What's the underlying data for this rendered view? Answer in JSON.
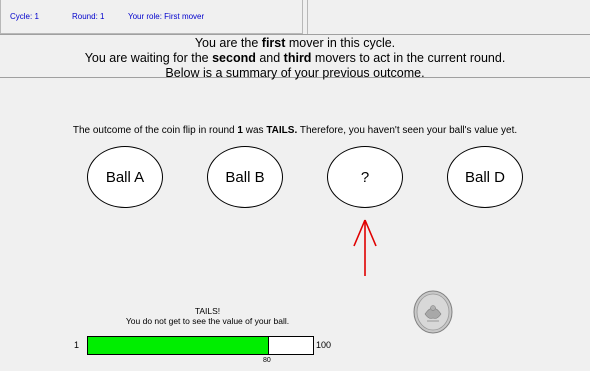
{
  "status": {
    "cycle": "Cycle: 1",
    "round": "Round: 1",
    "role": "Your role: First mover"
  },
  "header": {
    "line1_pre": "You are the ",
    "line1_bold": "first",
    "line1_post": " mover in this cycle.",
    "line2_pre": "You are waiting for the ",
    "line2_bold1": "second",
    "line2_mid": " and ",
    "line2_bold2": "third",
    "line2_post": " movers to act in the current round.",
    "line3": "Below is a summary of your previous outcome."
  },
  "outcome": {
    "pre": "The outcome of the coin flip in round ",
    "round": "1",
    "mid": " was ",
    "result": "TAILS.",
    "post": " Therefore, you haven't seen your ball's value yet."
  },
  "balls": [
    {
      "label": "Ball A"
    },
    {
      "label": "Ball B"
    },
    {
      "label": "?"
    },
    {
      "label": "Ball D"
    }
  ],
  "message": {
    "title": "TAILS!",
    "body": "You do not get to see the value of your ball."
  },
  "value_bar": {
    "min": "1",
    "max": "100",
    "value": 80,
    "value_label": "80",
    "fill_color": "#00ee00"
  },
  "colors": {
    "status_text": "#0000cc",
    "arrow": "#e00000"
  }
}
